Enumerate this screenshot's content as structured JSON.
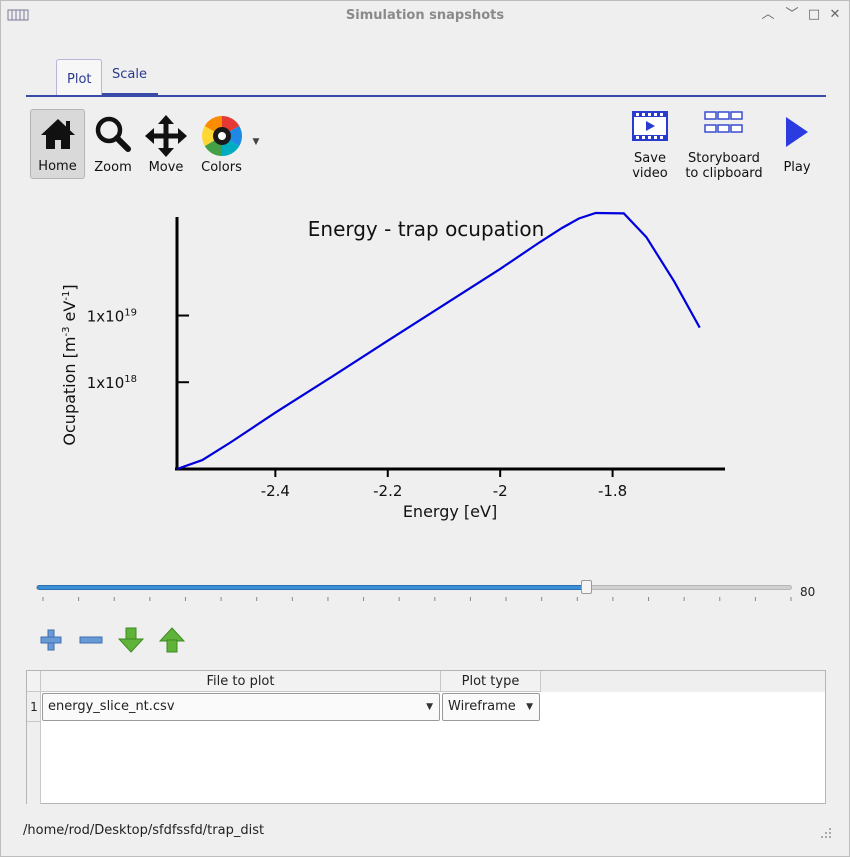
{
  "window": {
    "title": "Simulation snapshots"
  },
  "tabs": [
    {
      "label": "Plot",
      "active": true
    },
    {
      "label": "Scale",
      "active": false
    }
  ],
  "toolbar": {
    "home": "Home",
    "zoom": "Zoom",
    "move": "Move",
    "colors": "Colors",
    "save_video_1": "Save",
    "save_video_2": "video",
    "storyboard_1": "Storyboard",
    "storyboard_2": "to clipboard",
    "play": "Play"
  },
  "chart_data": {
    "type": "line",
    "title": "Energy - trap ocupation",
    "xlabel": "Energy [eV]",
    "ylabel_main": "Ocupation [m",
    "ylabel_sup1": "-3",
    "ylabel_mid": " eV",
    "ylabel_sup2": "-1",
    "ylabel_end": "]",
    "x_ticks": [
      "-2.4",
      "-2.2",
      "-2",
      "-1.8"
    ],
    "x_tick_values": [
      -2.4,
      -2.2,
      -2.0,
      -1.8
    ],
    "y_ticks": [
      {
        "base": "1x10",
        "exp": "19",
        "value": 1e+19
      },
      {
        "base": "1x10",
        "exp": "18",
        "value": 1e+18
      }
    ],
    "xlim": [
      -2.575,
      -1.6
    ],
    "y_scale": "log",
    "ylim": [
      5e+16,
      3e+20
    ],
    "series": [
      {
        "color": "#0000dd",
        "x": [
          -2.575,
          -2.53,
          -2.48,
          -2.4,
          -2.3,
          -2.2,
          -2.1,
          -2.0,
          -1.93,
          -1.89,
          -1.86,
          -1.83,
          -1.78,
          -1.74,
          -1.69,
          -1.645
        ],
        "y": [
          5e+16,
          6.8e+16,
          1.25e+17,
          3.5e+17,
          1.2e+18,
          4.2e+18,
          1.45e+19,
          5e+19,
          1.25e+20,
          2.05e+20,
          2.85e+20,
          3.7e+20,
          3.4e+20,
          1.5e+20,
          3.2e+19,
          6.6e+18
        ]
      }
    ]
  },
  "slider": {
    "value": 80,
    "value_label": "80",
    "fraction": 0.728
  },
  "table": {
    "headers": [
      "File to plot",
      "Plot type"
    ],
    "rows": [
      {
        "num": "1",
        "file": "energy_slice_nt.csv",
        "plot_type": "Wireframe"
      }
    ]
  },
  "status": {
    "path": "/home/rod/Desktop/sfdfssfd/trap_dist"
  },
  "icons": {
    "add": "add-icon",
    "remove": "remove-icon",
    "down": "move-down-icon",
    "up": "move-up-icon"
  }
}
